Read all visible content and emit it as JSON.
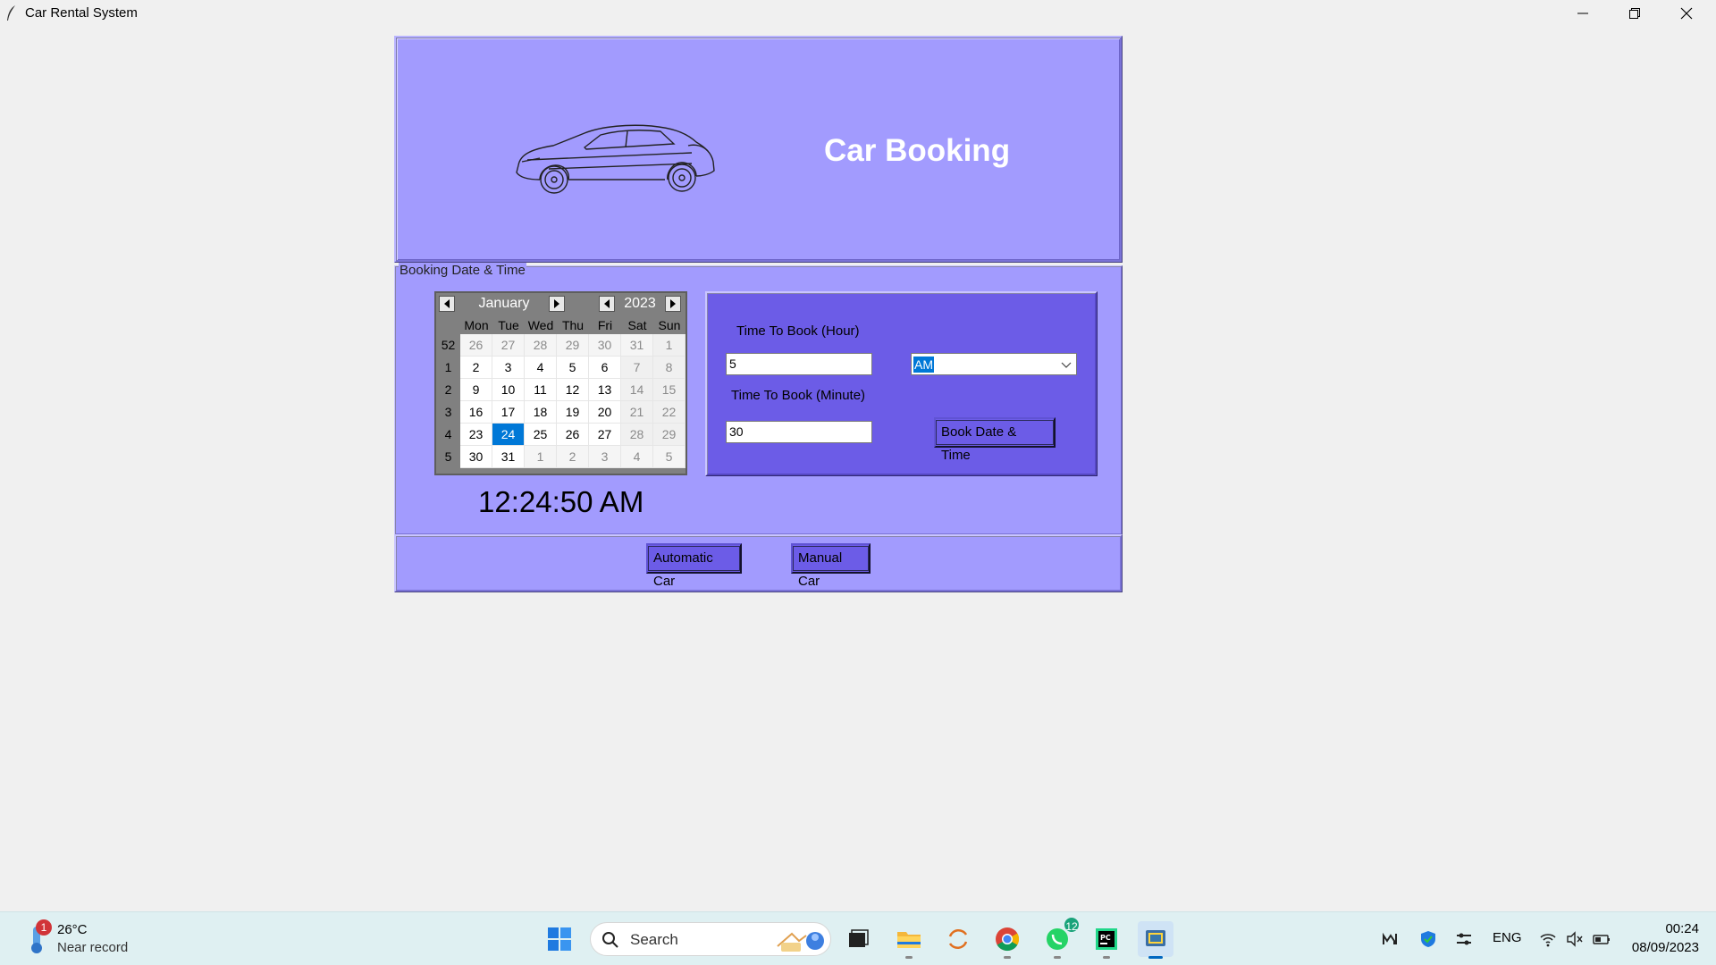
{
  "window": {
    "title": "Car Rental System",
    "icon": "feather-icon",
    "controls": [
      "minimize-icon",
      "restore-icon",
      "close-icon"
    ]
  },
  "header": {
    "title": "Car Booking",
    "image": "car-icon"
  },
  "booking": {
    "legend": "Booking Date & Time",
    "calendar": {
      "month": "January",
      "year": "2023",
      "weekdays": [
        "Mon",
        "Tue",
        "Wed",
        "Thu",
        "Fri",
        "Sat",
        "Sun"
      ],
      "weeks": [
        {
          "num": "52",
          "days": [
            "26",
            "27",
            "28",
            "29",
            "30",
            "31",
            "1"
          ]
        },
        {
          "num": "1",
          "days": [
            "2",
            "3",
            "4",
            "5",
            "6",
            "7",
            "8"
          ]
        },
        {
          "num": "2",
          "days": [
            "9",
            "10",
            "11",
            "12",
            "13",
            "14",
            "15"
          ]
        },
        {
          "num": "3",
          "days": [
            "16",
            "17",
            "18",
            "19",
            "20",
            "21",
            "22"
          ]
        },
        {
          "num": "4",
          "days": [
            "23",
            "24",
            "25",
            "26",
            "27",
            "28",
            "29"
          ]
        },
        {
          "num": "5",
          "days": [
            "30",
            "31",
            "1",
            "2",
            "3",
            "4",
            "5"
          ]
        }
      ],
      "selected_day": "24"
    },
    "clock": "12:24:50 AM",
    "hour_label": "Time To Book (Hour)",
    "hour_value": "5",
    "ampm_value": "AM",
    "minute_label": "Time To Book (Minute)",
    "minute_value": "30",
    "book_button": "Book Date & Time"
  },
  "bottom": {
    "automatic_button": "Automatic Car",
    "manual_button": "Manual Car"
  },
  "taskbar": {
    "weather": {
      "temp": "26°C",
      "desc": "Near record",
      "badge": "1"
    },
    "search_placeholder": "Search",
    "apps": [
      {
        "name": "start-icon"
      },
      {
        "name": "task-view-icon"
      },
      {
        "name": "file-explorer-icon"
      },
      {
        "name": "refresh-app-icon"
      },
      {
        "name": "chrome-icon"
      },
      {
        "name": "whatsapp-icon",
        "badge": "12"
      },
      {
        "name": "pycharm-icon"
      },
      {
        "name": "python-icon"
      }
    ],
    "tray": {
      "language": "ENG",
      "time": "00:24",
      "date": "08/09/2023"
    },
    "colors": {
      "accent": "#0067c0",
      "panel": "#6c5ce7",
      "frame": "#a29bfe",
      "selected": "#0078d7"
    }
  }
}
